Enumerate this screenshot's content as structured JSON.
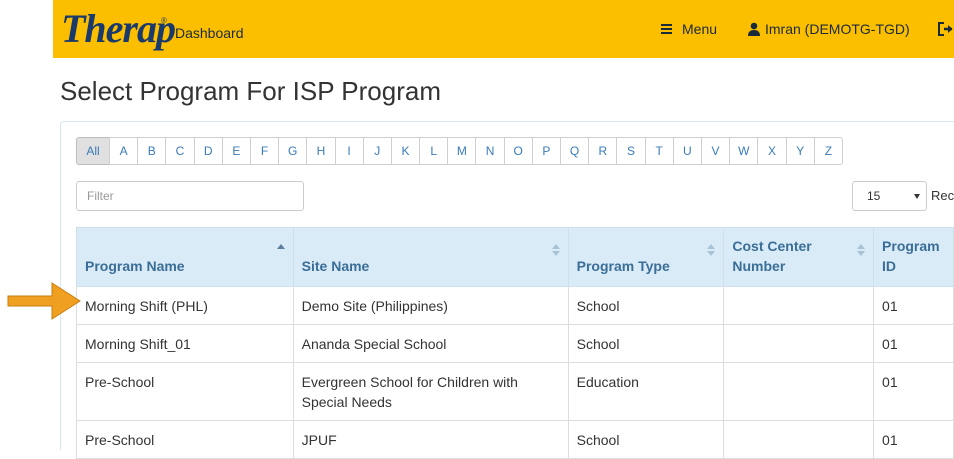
{
  "header": {
    "logo_text": "Therap",
    "logo_mark": "®",
    "dashboard_label": "Dashboard",
    "menu_label": "Menu",
    "user_label": "Imran (DEMOTG-TGD)"
  },
  "page": {
    "title": "Select Program For ISP Program"
  },
  "alpha_filter": [
    "All",
    "A",
    "B",
    "C",
    "D",
    "E",
    "F",
    "G",
    "H",
    "I",
    "J",
    "K",
    "L",
    "M",
    "N",
    "O",
    "P",
    "Q",
    "R",
    "S",
    "T",
    "U",
    "V",
    "W",
    "X",
    "Y",
    "Z"
  ],
  "filter": {
    "placeholder": "Filter"
  },
  "page_size": {
    "value": "15",
    "records_label": "Rec"
  },
  "table": {
    "headers": [
      "Program Name",
      "Site Name",
      "Program Type",
      "Cost Center Number",
      "Program ID"
    ],
    "rows": [
      [
        "Morning Shift (PHL)",
        "Demo Site (Philippines)",
        "School",
        "",
        "01"
      ],
      [
        "Morning Shift_01",
        "Ananda Special School",
        "School",
        "",
        "01"
      ],
      [
        "Pre-School",
        "Evergreen School for Children with Special Needs",
        "Education",
        "",
        "01"
      ],
      [
        "Pre-School",
        "JPUF",
        "School",
        "",
        "01"
      ]
    ]
  },
  "colors": {
    "header_bg": "#fbbf00",
    "table_header_bg": "#d9ebf6",
    "table_header_text": "#3b6e97",
    "link": "#3a7bb8",
    "arrow": "#f0a020"
  }
}
